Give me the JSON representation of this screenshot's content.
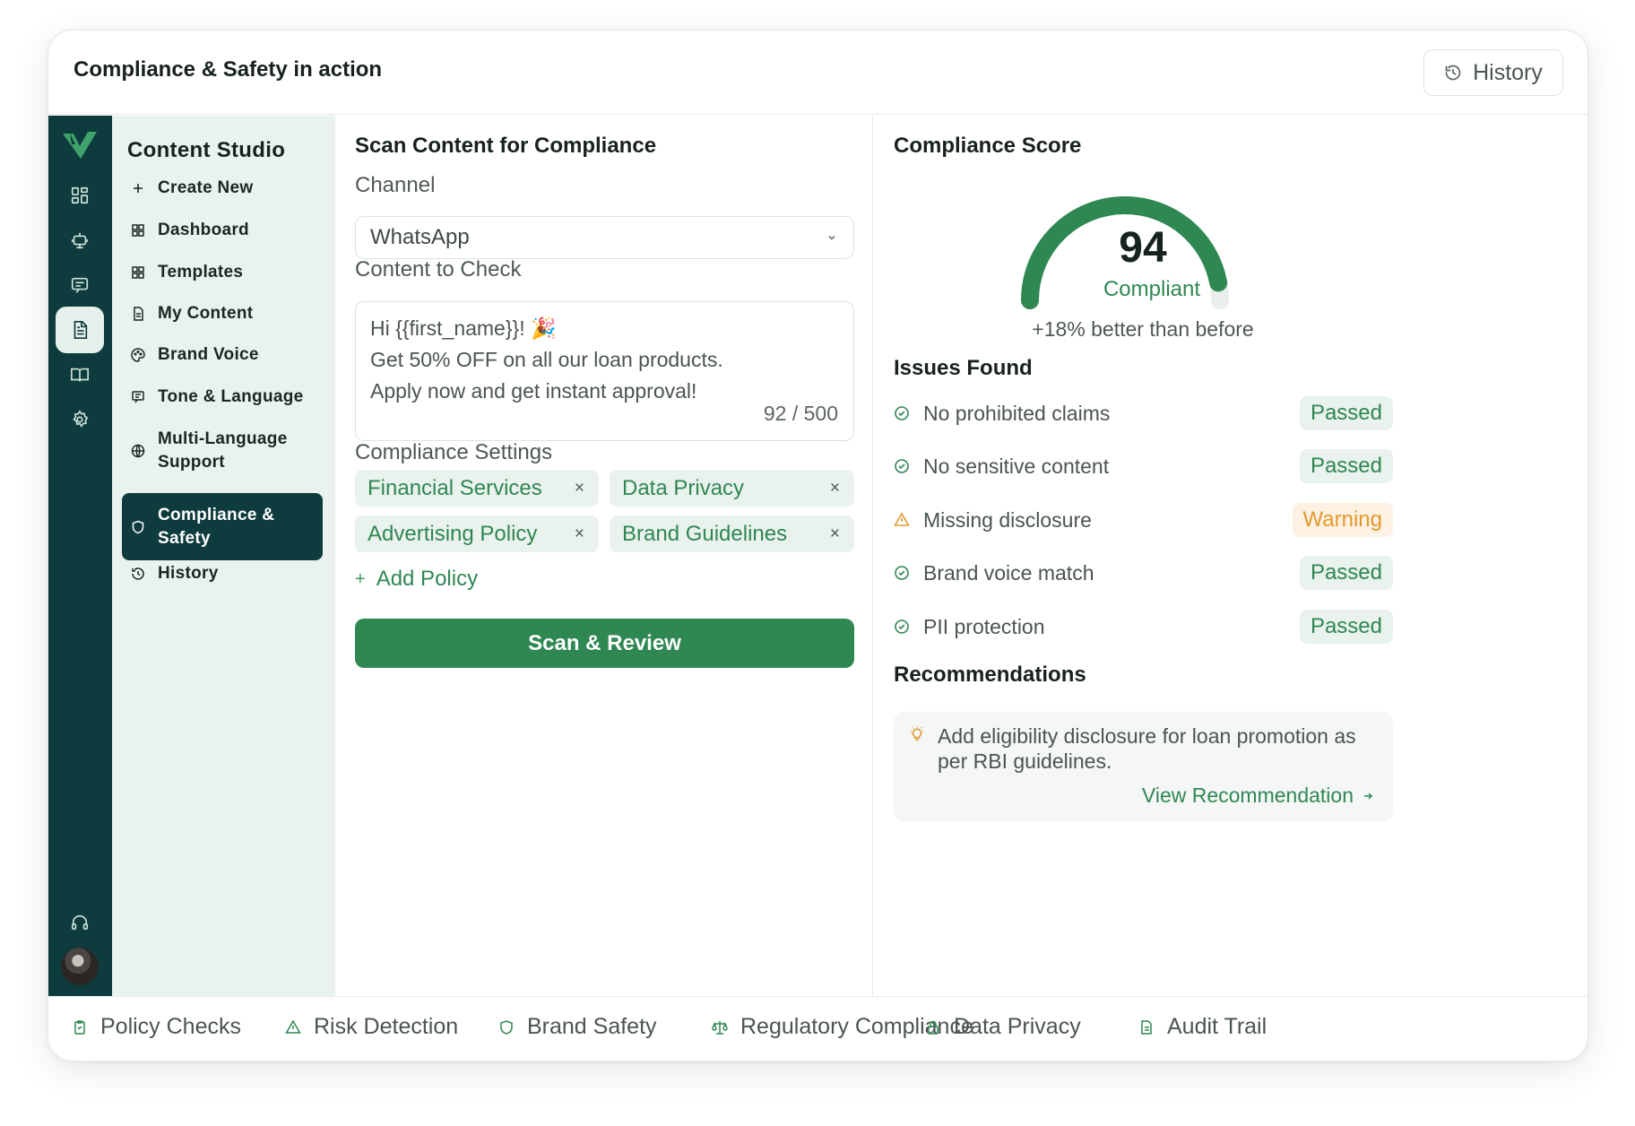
{
  "header": {
    "title": "Compliance & Safety in action",
    "history_label": "History"
  },
  "rail": {
    "icons": [
      "grid-icon",
      "robot-icon",
      "message-icon",
      "document-icon",
      "book-icon",
      "gear-icon"
    ],
    "bottom_icons": [
      "headset-icon",
      "avatar"
    ]
  },
  "sidebar": {
    "title": "Content Studio",
    "items": [
      {
        "label": "Create New",
        "icon": "plus-icon"
      },
      {
        "label": "Dashboard",
        "icon": "grid-icon"
      },
      {
        "label": "Templates",
        "icon": "grid-icon"
      },
      {
        "label": "My Content",
        "icon": "document-icon"
      },
      {
        "label": "Brand Voice",
        "icon": "palette-icon"
      },
      {
        "label": "Tone & Language",
        "icon": "message-icon"
      },
      {
        "label": "Multi-Language Support",
        "icon": "globe-icon"
      },
      {
        "label": "Compliance & Safety",
        "icon": "shield-icon",
        "active": true
      },
      {
        "label": "History",
        "icon": "history-icon"
      }
    ]
  },
  "scan": {
    "title": "Scan Content for Compliance",
    "channel_label": "Channel",
    "channel_value": "WhatsApp",
    "content_label": "Content to Check",
    "content_lines": [
      "Hi {{first_name}}! 🎉",
      "Get 50% OFF on all our loan products.",
      "Apply now and get instant approval!"
    ],
    "char_count": "92 / 500",
    "settings_label": "Compliance Settings",
    "policies": [
      "Financial Services",
      "Data Privacy",
      "Advertising Policy",
      "Brand Guidelines"
    ],
    "remove_symbol": "×",
    "add_policy_label": "Add Policy",
    "scan_button": "Scan & Review"
  },
  "score": {
    "title": "Compliance Score",
    "value": 94,
    "value_label": "94",
    "status": "Compliant",
    "delta": "+18% better than before",
    "issues_title": "Issues Found",
    "issues": [
      {
        "name": "No prohibited claims",
        "status": "Passed",
        "type": "pass"
      },
      {
        "name": "No sensitive content",
        "status": "Passed",
        "type": "pass"
      },
      {
        "name": "Missing disclosure",
        "status": "Warning",
        "type": "warn"
      },
      {
        "name": "Brand voice match",
        "status": "Passed",
        "type": "pass"
      },
      {
        "name": "PII protection",
        "status": "Passed",
        "type": "pass"
      }
    ],
    "recommendations_title": "Recommendations",
    "recommendation_text": "Add eligibility disclosure for loan promotion as per RBI guidelines.",
    "recommendation_link": "View Recommendation",
    "colors": {
      "accent": "#2f8752",
      "warning": "#e39a2a",
      "track": "#e9eded"
    }
  },
  "footer": {
    "items": [
      {
        "label": "Policy Checks",
        "icon": "clipboard-icon"
      },
      {
        "label": "Risk Detection",
        "icon": "warning-icon"
      },
      {
        "label": "Brand Safety",
        "icon": "shield-icon"
      },
      {
        "label": "Regulatory Compliance",
        "icon": "scale-icon"
      },
      {
        "label": "Data Privacy",
        "icon": "lock-icon"
      },
      {
        "label": "Audit Trail",
        "icon": "document-icon"
      }
    ]
  }
}
